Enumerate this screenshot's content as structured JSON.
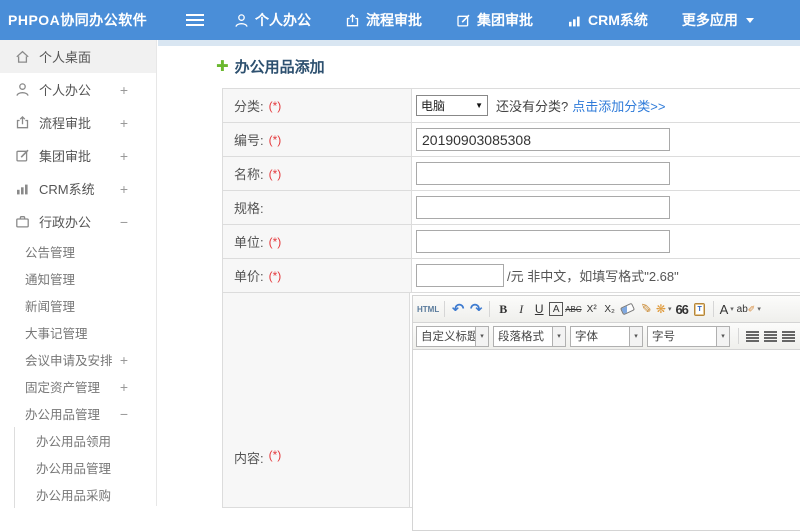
{
  "colors": {
    "header_blue": "#4a8ed8",
    "link_blue": "#2f7bd9",
    "required_red": "#e4393c",
    "title_navy": "#2d506f",
    "add_green": "#6ab82e",
    "label_cell_bg": "#f7f7f7"
  },
  "header": {
    "logo": "PHPOA协同办公软件",
    "nav": [
      {
        "label": "个人办公",
        "icon": "person-icon"
      },
      {
        "label": "流程审批",
        "icon": "flow-icon"
      },
      {
        "label": "集团审批",
        "icon": "edit-icon"
      },
      {
        "label": "CRM系统",
        "icon": "chart-icon"
      },
      {
        "label": "更多应用",
        "icon": "caret-down-icon"
      }
    ]
  },
  "sidebar": {
    "items": [
      {
        "label": "个人桌面",
        "icon": "home-icon",
        "expand": ""
      },
      {
        "label": "个人办公",
        "icon": "person-icon",
        "expand": "+"
      },
      {
        "label": "流程审批",
        "icon": "flow-icon",
        "expand": "+"
      },
      {
        "label": "集团审批",
        "icon": "edit-icon",
        "expand": "+"
      },
      {
        "label": "CRM系统",
        "icon": "chart-icon",
        "expand": "+"
      },
      {
        "label": "行政办公",
        "icon": "briefcase-icon",
        "expand": "−"
      }
    ],
    "admin_subitems": [
      {
        "label": "公告管理",
        "expand": ""
      },
      {
        "label": "通知管理",
        "expand": ""
      },
      {
        "label": "新闻管理",
        "expand": ""
      },
      {
        "label": "大事记管理",
        "expand": ""
      },
      {
        "label": "会议申请及安排",
        "expand": "+"
      },
      {
        "label": "固定资产管理",
        "expand": "+"
      },
      {
        "label": "办公用品管理",
        "expand": "−"
      }
    ],
    "supplies_subitems": [
      {
        "label": "办公用品领用"
      },
      {
        "label": "办公用品管理"
      },
      {
        "label": "办公用品采购"
      }
    ]
  },
  "main": {
    "add_icon_glyph": "✚",
    "page_title": "办公用品添加",
    "form": {
      "rows": [
        {
          "label": "分类:",
          "required": "(*)"
        },
        {
          "label": "编号:",
          "required": "(*)"
        },
        {
          "label": "名称:",
          "required": "(*)"
        },
        {
          "label": "规格:",
          "required": ""
        },
        {
          "label": "单位:",
          "required": "(*)"
        },
        {
          "label": "单价:",
          "required": "(*)"
        },
        {
          "label": "内容:",
          "required": "(*)"
        }
      ],
      "category": {
        "value": "电脑",
        "select_caret": "▼",
        "hint": "还没有分类?",
        "link": "点击添加分类>>"
      },
      "code_value": "20190903085308",
      "name_value": "",
      "spec_value": "",
      "unit_value": "",
      "price_value": "",
      "price_suffix": "/元 非中文，如填写格式\"2.68\""
    },
    "editor": {
      "html_label": "HTML",
      "undo_glyph": "↶",
      "redo_glyph": "↷",
      "bold": "B",
      "italic": "I",
      "underline": "U",
      "char_border": "A",
      "strike": "ABC",
      "superscript": "X²",
      "subscript": "X₂",
      "format_painter_glyph": "✐",
      "autoformat_glyph": "❋",
      "quote": "66",
      "paste_t": "T",
      "font_color": "A",
      "highlight": "ab",
      "highlight_pen_glyph": "✐",
      "caret": "▾",
      "selects": [
        {
          "label": "自定义标题"
        },
        {
          "label": "段落格式"
        },
        {
          "label": "字体"
        },
        {
          "label": "字号"
        }
      ],
      "link_glyph": "∞"
    }
  }
}
